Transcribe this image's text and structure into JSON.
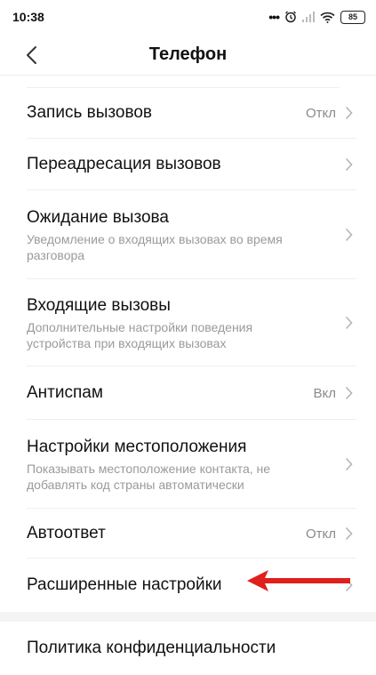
{
  "status": {
    "time": "10:38",
    "battery": "85"
  },
  "header": {
    "title": "Телефон"
  },
  "rows": [
    {
      "title": "Запись вызовов",
      "value": "Откл"
    },
    {
      "title": "Переадресация вызовов"
    },
    {
      "title": "Ожидание вызова",
      "subtitle": "Уведомление о входящих вызовах во время разговора"
    },
    {
      "title": "Входящие вызовы",
      "subtitle": "Дополнительные настройки поведения устройства при входящих вызовах"
    },
    {
      "title": "Антиспам",
      "value": "Вкл"
    },
    {
      "title": "Настройки местоположения",
      "subtitle": "Показывать местоположение контакта, не добавлять код страны автоматически"
    },
    {
      "title": "Автоответ",
      "value": "Откл"
    },
    {
      "title": "Расширенные настройки"
    }
  ],
  "footer_rows": [
    {
      "title": "Политика конфиденциальности"
    }
  ],
  "colors": {
    "annotation_arrow": "#e0201c",
    "divider": "#eeeeee",
    "secondary_text": "#9a9a9a"
  }
}
